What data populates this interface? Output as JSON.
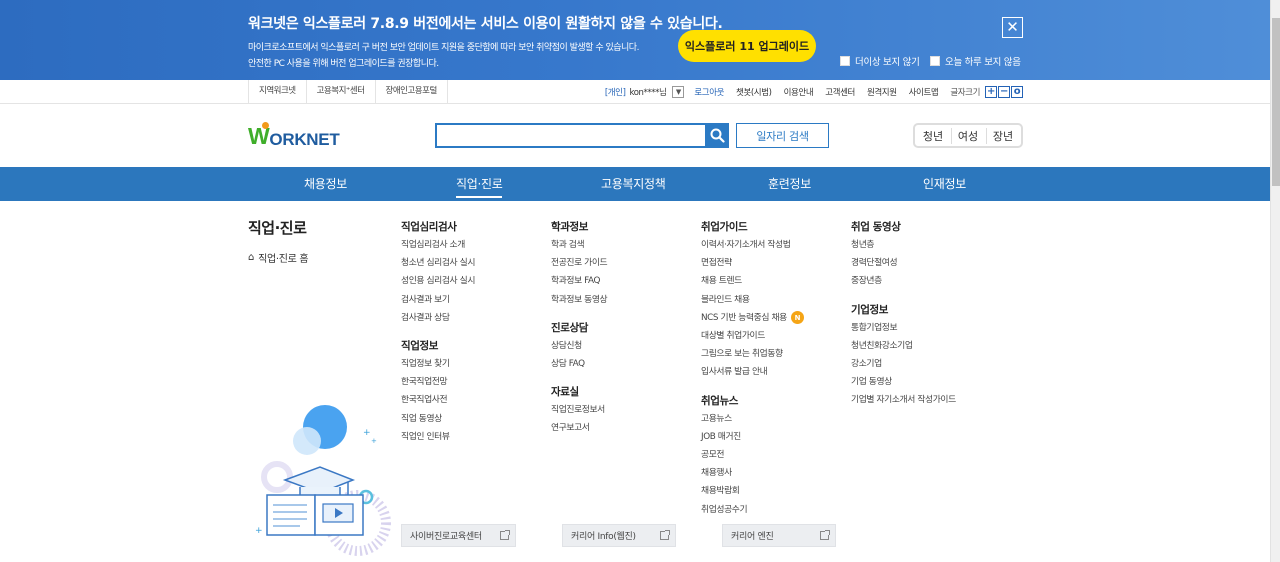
{
  "banner": {
    "title": "워크넷은 익스플로러 7.8.9 버전에서는 서비스 이용이 원활하지 않을 수 있습니다.",
    "desc_line1": "마이크로소프트에서 익스플로러 구 버전 보안 업데이트 지원을 중단함에 따라 보안 취약점이 발생할 수 있습니다.",
    "desc_line2": "안전한 PC 사용을 위해 버전 업그레이드를 권장합니다.",
    "upgrade_label": "익스플로러 11 업그레이드",
    "close_label": "✕",
    "never_show_label": "더이상 보지 않기",
    "today_hide_label": "오늘 하루 보지 않음"
  },
  "util": {
    "left_links": [
      "지역워크넷",
      "고용복지⁺센터",
      "장애인고용포털"
    ],
    "user_tag": "[개인]",
    "user_name": "kon****님",
    "dropdown_icon": "▼",
    "logout": "로그아웃",
    "links": [
      "챗봇(시범)",
      "이용안내",
      "고객센터",
      "원격지원",
      "사이트맵"
    ],
    "font_size_label": "글자크기",
    "font_plus": "+",
    "font_minus": "−",
    "font_reset": "o"
  },
  "header": {
    "logo_w": "W",
    "logo_rest": "ORKNET",
    "search_placeholder": "",
    "job_search_label": "일자리 검색",
    "target_tabs": [
      "청년",
      "여성",
      "장년"
    ]
  },
  "gnb": {
    "items": [
      "채용정보",
      "직업·진로",
      "고용복지정책",
      "훈련정보",
      "인재정보"
    ],
    "active_index": 1
  },
  "section": {
    "title": "직업·진로",
    "home_icon": "⌂",
    "home_label": "직업·진로 홈"
  },
  "columns": [
    {
      "groups": [
        {
          "title": "직업심리검사",
          "items": [
            "직업심리검사 소개",
            "청소년 심리검사 실시",
            "성인용 심리검사 실시",
            "검사결과 보기",
            "검사결과 상담"
          ]
        },
        {
          "title": "직업정보",
          "items": [
            "직업정보 찾기",
            "한국직업전망",
            "한국직업사전",
            "직업 동영상",
            "직업인 인터뷰"
          ]
        }
      ]
    },
    {
      "groups": [
        {
          "title": "학과정보",
          "items": [
            "학과 검색",
            "전공진로 가이드",
            "학과정보 FAQ",
            "학과정보 동영상"
          ]
        },
        {
          "title": "진로상담",
          "items": [
            "상담신청",
            "상담 FAQ"
          ]
        },
        {
          "title": "자료실",
          "items": [
            "직업진로정보서",
            "연구보고서"
          ]
        }
      ]
    },
    {
      "groups": [
        {
          "title": "취업가이드",
          "items": [
            "이력서·자기소개서 작성법",
            "면접전략",
            "채용 트렌드",
            "블라인드 채용",
            "NCS 기반 능력중심 채용",
            "대상별 취업가이드",
            "그림으로 보는 취업동향",
            "입사서류 발급 안내"
          ],
          "new_badge_index": 4,
          "new_badge": "N"
        },
        {
          "title": "취업뉴스",
          "items": [
            "고용뉴스",
            "JOB 매거진",
            "공모전",
            "채용행사",
            "채용박람회",
            "취업성공수기"
          ]
        }
      ]
    },
    {
      "groups": [
        {
          "title": "취업 동영상",
          "items": [
            "청년층",
            "경력단절여성",
            "중장년층"
          ]
        },
        {
          "title": "기업정보",
          "items": [
            "통합기업정보",
            "청년친화강소기업",
            "강소기업",
            "기업 동영상",
            "기업별 자기소개서 작성가이드"
          ]
        }
      ]
    }
  ],
  "bottom_links": [
    "사이버진로교육센터",
    "커리어 Info(웹진)",
    "커리어 엔진"
  ],
  "colors": {
    "banner": "#3778cc",
    "upgrade_button": "#ffe000",
    "gnb": "#2c77bd",
    "brand_green": "#3fae2a",
    "brand_blue": "#1f5c9f",
    "new_badge": "#f5a516"
  }
}
